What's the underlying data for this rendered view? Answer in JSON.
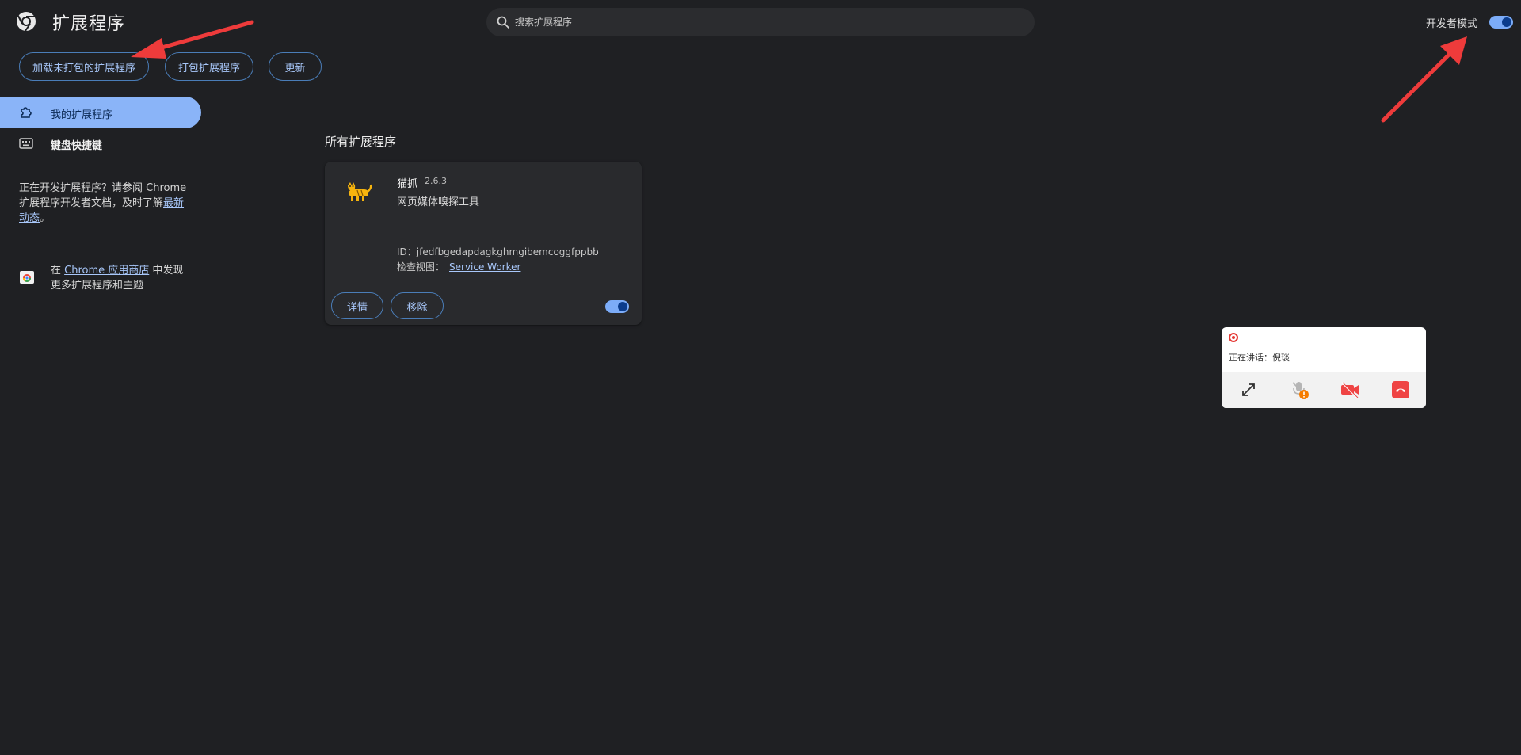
{
  "header": {
    "title": "扩展程序",
    "search_placeholder": "搜索扩展程序",
    "dev_mode_label": "开发者模式",
    "dev_mode_on": true
  },
  "toolbar": {
    "load_unpacked": "加载未打包的扩展程序",
    "pack": "打包扩展程序",
    "update": "更新"
  },
  "sidebar": {
    "items": [
      {
        "label": "我的扩展程序",
        "icon": "extension-icon",
        "active": true
      },
      {
        "label": "键盘快捷键",
        "icon": "keyboard-icon",
        "active": false
      }
    ],
    "dev_text_part1": "正在开发扩展程序？请参阅 Chrome 扩展程序开发者文档，及时了解",
    "dev_link": "最新动态",
    "dev_text_end": "。",
    "store_prefix": "在 ",
    "store_link": "Chrome 应用商店",
    "store_suffix": " 中发现更多扩展程序和主题"
  },
  "main": {
    "section_title": "所有扩展程序",
    "extension": {
      "name": "猫抓",
      "version": "2.6.3",
      "description": "网页媒体嗅探工具",
      "id_line": "ID：jfedfbgedapdagkghmgibemcoggfppbb",
      "views_label": "检查视图：",
      "views_link": "Service Worker",
      "details_label": "详情",
      "remove_label": "移除",
      "enabled": true
    }
  },
  "call_widget": {
    "speaking": "正在讲话：倪琰",
    "controls": [
      "expand-icon",
      "mic-muted-icon",
      "camera-off-icon",
      "hang-up-icon"
    ]
  },
  "colors": {
    "background": "#1f2023",
    "accent": "#8ab4f8",
    "annotation_arrow": "#ee3b3b"
  }
}
